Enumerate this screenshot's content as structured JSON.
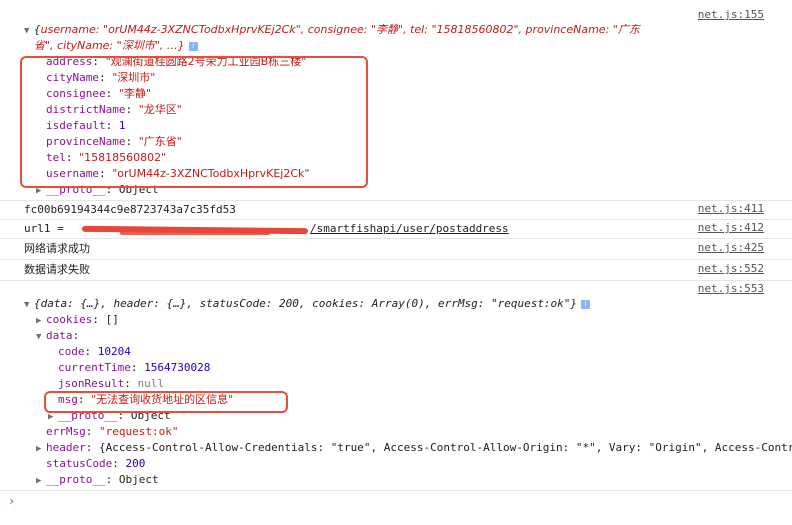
{
  "log1": {
    "source": "net.js:155",
    "summary_l1_prefix": "{",
    "summary_l1_content": "username: \"orUM44z-3XZNCTodbxHprvKEj2Ck\", consignee: \"李静\", tel: \"15818560802\", provinceName: \"广东",
    "summary_l2": "省\", cityName: \"深圳市\", …}",
    "props": [
      {
        "key": "address",
        "value": "\"观澜街道桂圆路2号荣力工业园B栋三楼\"",
        "kind": "str"
      },
      {
        "key": "cityName",
        "value": "\"深圳市\"",
        "kind": "str"
      },
      {
        "key": "consignee",
        "value": "\"李静\"",
        "kind": "str"
      },
      {
        "key": "districtName",
        "value": "\"龙华区\"",
        "kind": "str"
      },
      {
        "key": "isdefault",
        "value": "1",
        "kind": "num"
      },
      {
        "key": "provinceName",
        "value": "\"广东省\"",
        "kind": "str"
      },
      {
        "key": "tel",
        "value": "\"15818560802\"",
        "kind": "str"
      },
      {
        "key": "username",
        "value": "\"orUM44z-3XZNCTodbxHprvKEj2Ck\"",
        "kind": "str"
      }
    ],
    "proto_key": "__proto__",
    "proto_val": "Object"
  },
  "log2": {
    "text": "fc00b69194344c9e8723743a7c35fd53",
    "source": "net.js:411"
  },
  "log3": {
    "prefix": "url1 = ",
    "visible_path": "/smartfishapi/user/postaddress",
    "source": "net.js:412"
  },
  "log4": {
    "text": "网络请求成功",
    "source": "net.js:425"
  },
  "log5": {
    "text": "数据请求失败",
    "source": "net.js:552"
  },
  "log6": {
    "source": "net.js:553",
    "summary": "{data: {…}, header: {…}, statusCode: 200, cookies: Array(0), errMsg: \"request:ok\"}",
    "cookies_key": "cookies",
    "cookies_val": "[]",
    "data_key": "data",
    "data_props": [
      {
        "key": "code",
        "value": "10204",
        "kind": "num"
      },
      {
        "key": "currentTime",
        "value": "1564730028",
        "kind": "num"
      },
      {
        "key": "jsonResult",
        "value": "null",
        "kind": "nul"
      },
      {
        "key": "msg",
        "value": "\"无法查询收货地址的区信息\"",
        "kind": "str"
      }
    ],
    "data_proto_key": "__proto__",
    "data_proto_val": "Object",
    "errmsg_key": "errMsg",
    "errmsg_val": "\"request:ok\"",
    "header_key": "header",
    "header_val": "{Access-Control-Allow-Credentials: \"true\", Access-Control-Allow-Origin: \"*\", Vary: \"Origin\", Access-Contr",
    "status_key": "statusCode",
    "status_val": "200",
    "proto_key": "__proto__",
    "proto_val": "Object"
  },
  "prompt_symbol": "›",
  "colors": {
    "key": "#881391",
    "string": "#c41a16",
    "number": "#1c00cf",
    "highlight": "#e64f3c",
    "prompt": "#1a73e8"
  }
}
